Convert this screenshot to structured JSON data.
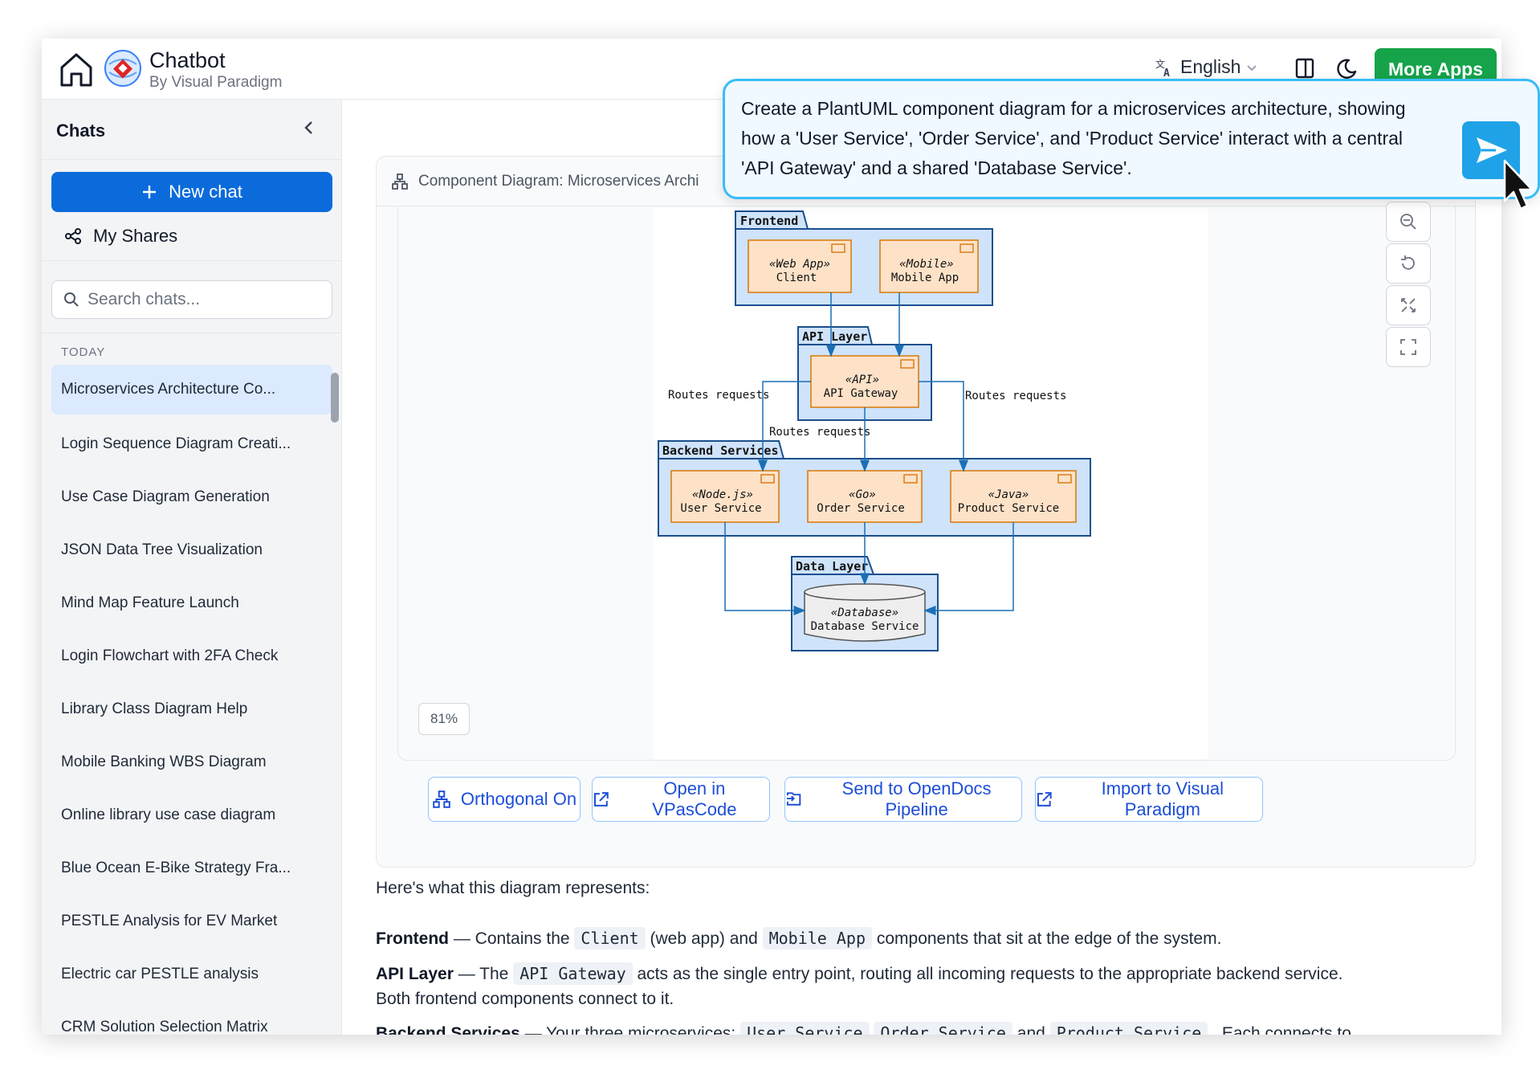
{
  "header": {
    "title": "Chatbot",
    "subtitle": "By Visual Paradigm",
    "language": "English",
    "more_apps": "More Apps"
  },
  "sidebar": {
    "heading": "Chats",
    "new_chat": "New chat",
    "my_shares": "My Shares",
    "search_placeholder": "Search chats...",
    "section": "TODAY",
    "items": [
      "Microservices Architecture Co...",
      "Login Sequence Diagram Creati...",
      "Use Case Diagram Generation",
      "JSON Data Tree Visualization",
      "Mind Map Feature Launch",
      "Login Flowchart with 2FA Check",
      "Library Class Diagram Help",
      "Mobile Banking WBS Diagram",
      "Online library use case diagram",
      "Blue Ocean E-Bike Strategy Fra...",
      "PESTLE Analysis for EV Market",
      "Electric car PESTLE analysis",
      "CRM Solution Selection Matrix"
    ]
  },
  "card": {
    "title": "Component Diagram: Microservices Archi",
    "zoom": "81%",
    "actions": {
      "orthogonal": "Orthogonal On",
      "vpascode": "Open in VPasCode",
      "opendocs": "Send to OpenDocs Pipeline",
      "import": "Import to Visual Paradigm"
    }
  },
  "diagram": {
    "frontend": "Frontend",
    "api_layer": "API Layer",
    "backend": "Backend Services",
    "data_layer": "Data Layer",
    "web_stereo": "«Web App»",
    "web_name": "Client",
    "mobile_stereo": "«Mobile»",
    "mobile_name": "Mobile App",
    "api_stereo": "«API»",
    "api_name": "API Gateway",
    "user_stereo": "«Node.js»",
    "user_name": "User Service",
    "order_stereo": "«Go»",
    "order_name": "Order Service",
    "product_stereo": "«Java»",
    "product_name": "Product Service",
    "db_stereo": "«Database»",
    "db_name": "Database Service",
    "route_left": "Routes requests",
    "route_mid": "Routes requests",
    "route_right": "Routes requests"
  },
  "explanation": {
    "intro": "Here's what this diagram represents:",
    "frontend_label": "Frontend",
    "frontend_pre": " — Contains the ",
    "frontend_code1": "Client",
    "frontend_mid": " (web app) and ",
    "frontend_code2": "Mobile App",
    "frontend_post": " components that sit at the edge of the system.",
    "api_label": "API Layer",
    "api_pre": " — The ",
    "api_code": "API Gateway",
    "api_post": " acts as the single entry point, routing all incoming requests to the appropriate backend service.",
    "api_line2": "Both frontend components connect to it.",
    "backend_label": "Backend Services",
    "backend_pre": " — Your three microservices: ",
    "backend_code1": "User Service",
    "backend_code2": "Order Service",
    "backend_and": " and ",
    "backend_code3": "Product Service",
    "backend_post": " . Each connects to"
  },
  "prompt": {
    "text": "Create a PlantUML component diagram for a microservices architecture, showing how a 'User Service', 'Order Service', and 'Product Service' interact with a central 'API Gateway' and a shared 'Database Service'."
  },
  "colors": {
    "primary": "#0b6bdb",
    "green": "#16a34a",
    "package_fill": "#cfe3fb",
    "component_fill": "#fde2c8",
    "arrow": "#1b6fb5"
  }
}
